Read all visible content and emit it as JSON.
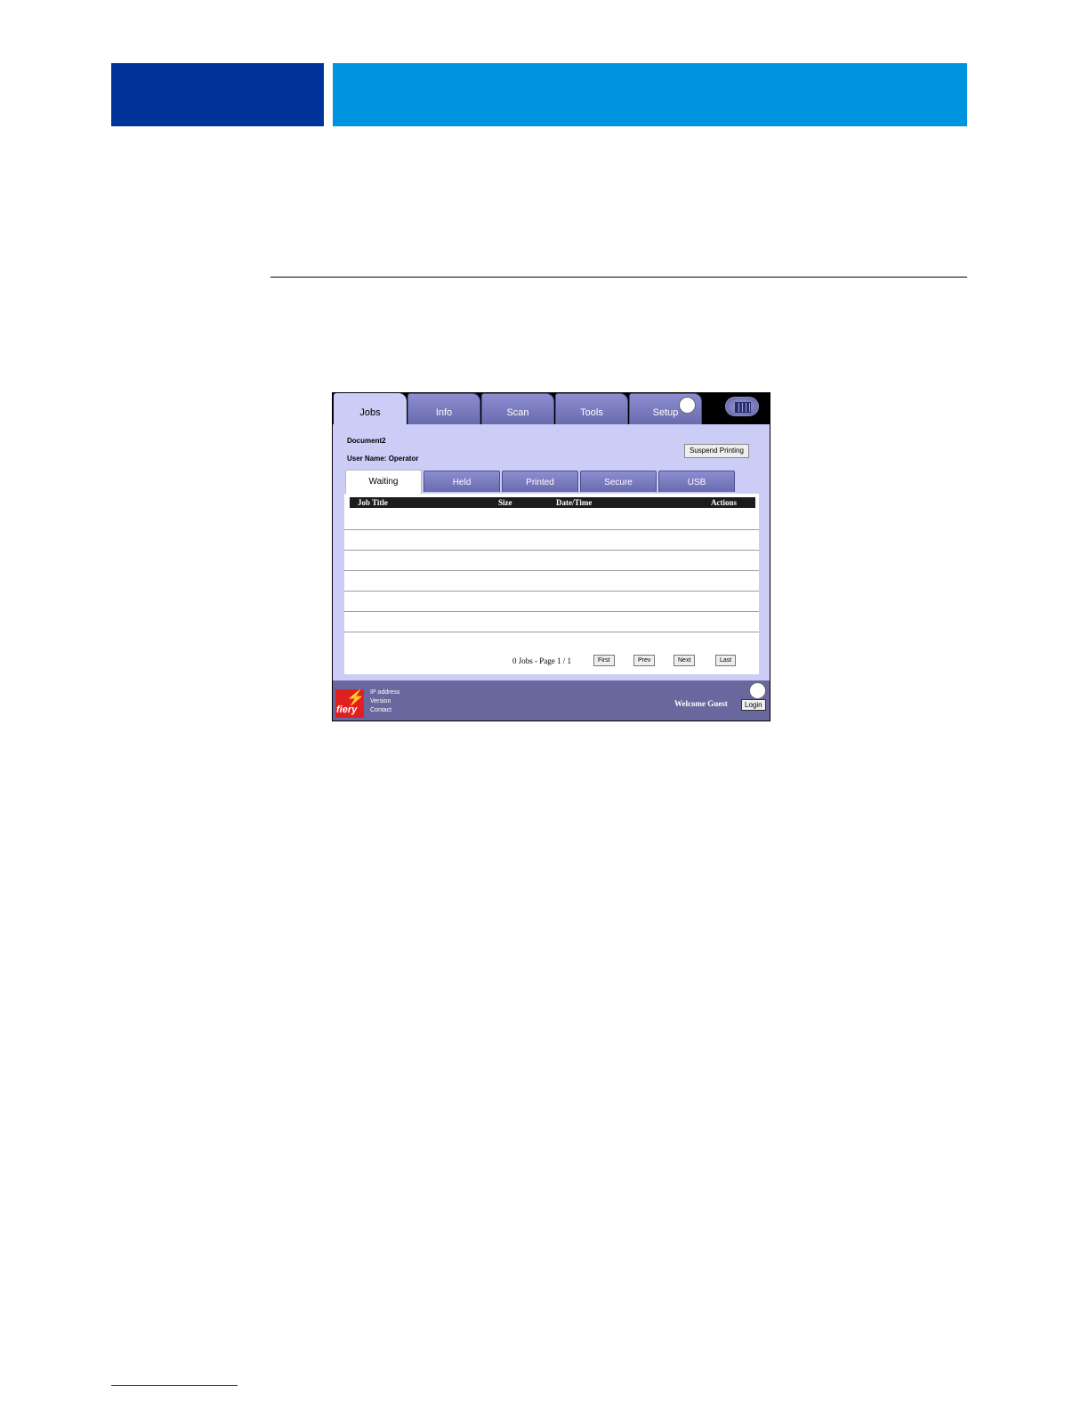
{
  "main_tabs": [
    "Jobs",
    "Info",
    "Scan",
    "Tools",
    "Setup"
  ],
  "document": "Document2",
  "user_name": "User Name: Operator",
  "suspend_label": "Suspend Printing",
  "sub_tabs": [
    "Waiting",
    "Held",
    "Printed",
    "Secure",
    "USB"
  ],
  "columns": [
    "Job Title",
    "Size",
    "Date/Time",
    "Actions"
  ],
  "pager": {
    "status": "0 Jobs - Page 1 / 1",
    "first": "First",
    "prev": "Prev",
    "next": "Next",
    "last": "Last"
  },
  "footer": {
    "logo_text": "fiery",
    "info": [
      "IP address",
      "Version",
      "Contact"
    ],
    "welcome": "Welcome Guest",
    "login": "Login"
  },
  "icons": {
    "logo": "fiery-logo",
    "app_switch": "grid-icon",
    "bolt": "lightning-icon"
  },
  "colors": {
    "header_dark": "#003399",
    "header_light": "#0094e0",
    "panel": "#cbcdf6",
    "tab": "#7a7bbf",
    "footer": "#68689e",
    "logo": "#e02020"
  }
}
